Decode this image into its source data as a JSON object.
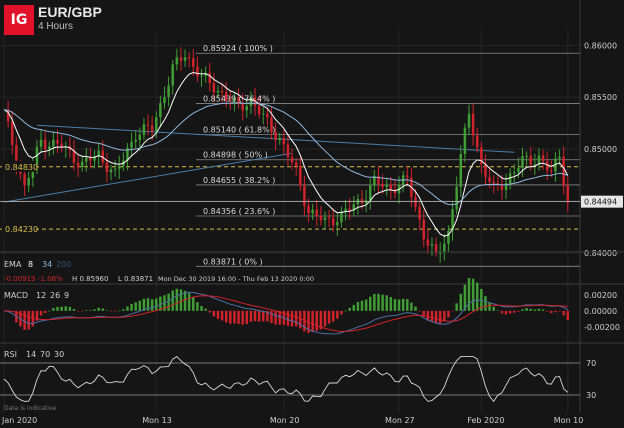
{
  "header": {
    "logo_text": "IG",
    "pair": "EUR/GBP",
    "timeframe": "4 Hours"
  },
  "disclaimer": "Data is indicative",
  "colors": {
    "up": "#3f9f34",
    "down": "#d0232a",
    "ema8": "#ffffff",
    "ema34": "#8fb8dc",
    "ema200": "#33557e",
    "fib": "#8a8a8a",
    "level": "#d8c04a",
    "macd": "#4f6fa8",
    "signal": "#d0232a",
    "rsi": "#d9d9d9"
  },
  "chart_data": {
    "type": "candlestick",
    "title": "EUR/GBP",
    "subtitle": "4 Hours",
    "price_axis": {
      "range": [
        0.8372,
        0.8609
      ],
      "ticks": [
        "0.86000",
        "0.85500",
        "0.85000",
        "0.84500",
        "0.84000"
      ],
      "tick_values": [
        0.86,
        0.855,
        0.85,
        0.845,
        0.84
      ]
    },
    "x_ticks": [
      "Jan 2020",
      "Mon 13",
      "Mon 20",
      "Mon 27",
      "Feb 2020",
      "Mon 10"
    ],
    "current_price": "0.84494",
    "fib_levels": [
      {
        "label": "0.85924 ( 100% )",
        "value": 0.85924
      },
      {
        "label": "0.85439 ( 76.4% )",
        "value": 0.85439
      },
      {
        "label": "0.85140 ( 61.8% )",
        "value": 0.8514
      },
      {
        "label": "0.84898 ( 50% )",
        "value": 0.84898
      },
      {
        "label": "0.84655 ( 38.2% )",
        "value": 0.84655
      },
      {
        "label": "0.84356 ( 23.6% )",
        "value": 0.84356
      },
      {
        "label": "0.83871 ( 0% )",
        "value": 0.83871
      }
    ],
    "horizontal_levels": [
      {
        "label": "0.84830",
        "value": 0.8483
      },
      {
        "label": "0.84230",
        "value": 0.8423
      }
    ],
    "trendline": {
      "from": {
        "x": 0,
        "y": 0.8449
      },
      "to": {
        "x": 60,
        "y": 0.8493
      }
    },
    "channel_line": {
      "from": {
        "x": 8,
        "y": 0.8523
      },
      "to": {
        "x": 124,
        "y": 0.8497
      }
    },
    "key_points": [
      {
        "x": 0,
        "y": 0.8535
      },
      {
        "x": 5,
        "y": 0.8462
      },
      {
        "x": 9,
        "y": 0.8508
      },
      {
        "x": 14,
        "y": 0.8503
      },
      {
        "x": 19,
        "y": 0.8485
      },
      {
        "x": 23,
        "y": 0.8495
      },
      {
        "x": 27,
        "y": 0.8475
      },
      {
        "x": 32,
        "y": 0.8515
      },
      {
        "x": 36,
        "y": 0.852
      },
      {
        "x": 41,
        "y": 0.8577
      },
      {
        "x": 44,
        "y": 0.8592
      },
      {
        "x": 48,
        "y": 0.8569
      },
      {
        "x": 52,
        "y": 0.8557
      },
      {
        "x": 57,
        "y": 0.854
      },
      {
        "x": 60,
        "y": 0.8548
      },
      {
        "x": 63,
        "y": 0.853
      },
      {
        "x": 67,
        "y": 0.851
      },
      {
        "x": 71,
        "y": 0.8478
      },
      {
        "x": 74,
        "y": 0.844
      },
      {
        "x": 78,
        "y": 0.843
      },
      {
        "x": 82,
        "y": 0.8436
      },
      {
        "x": 87,
        "y": 0.8452
      },
      {
        "x": 90,
        "y": 0.8468
      },
      {
        "x": 94,
        "y": 0.8462
      },
      {
        "x": 98,
        "y": 0.847
      },
      {
        "x": 102,
        "y": 0.8418
      },
      {
        "x": 105,
        "y": 0.8395
      },
      {
        "x": 108,
        "y": 0.842
      },
      {
        "x": 111,
        "y": 0.8492
      },
      {
        "x": 113,
        "y": 0.8535
      },
      {
        "x": 116,
        "y": 0.8485
      },
      {
        "x": 119,
        "y": 0.846
      },
      {
        "x": 122,
        "y": 0.847
      },
      {
        "x": 126,
        "y": 0.8488
      },
      {
        "x": 130,
        "y": 0.8492
      },
      {
        "x": 133,
        "y": 0.8476
      },
      {
        "x": 135,
        "y": 0.8495
      },
      {
        "x": 137,
        "y": 0.8449
      }
    ],
    "ema_legend": {
      "label": "EMA",
      "periods": [
        "8",
        "34",
        "200"
      ],
      "values": [
        "-0.00919",
        "-1.08%",
        "H 0.85960",
        "L 0.83871",
        "Mon Dec 30 2019 16:00 - Thu Feb 13 2020 0:00"
      ]
    },
    "macd": {
      "label": "MACD",
      "params": [
        "12",
        "26",
        "9"
      ],
      "range": [
        -0.0029,
        0.0026
      ],
      "ticks": [
        "0.00200",
        "0.00000",
        "-0.00200"
      ],
      "tick_values": [
        0.002,
        0,
        -0.002
      ]
    },
    "rsi": {
      "label": "RSI",
      "params": [
        "14",
        "70",
        "30"
      ],
      "range": [
        15,
        85
      ],
      "ticks": [
        "70",
        "30"
      ],
      "tick_values": [
        70,
        30
      ]
    }
  }
}
